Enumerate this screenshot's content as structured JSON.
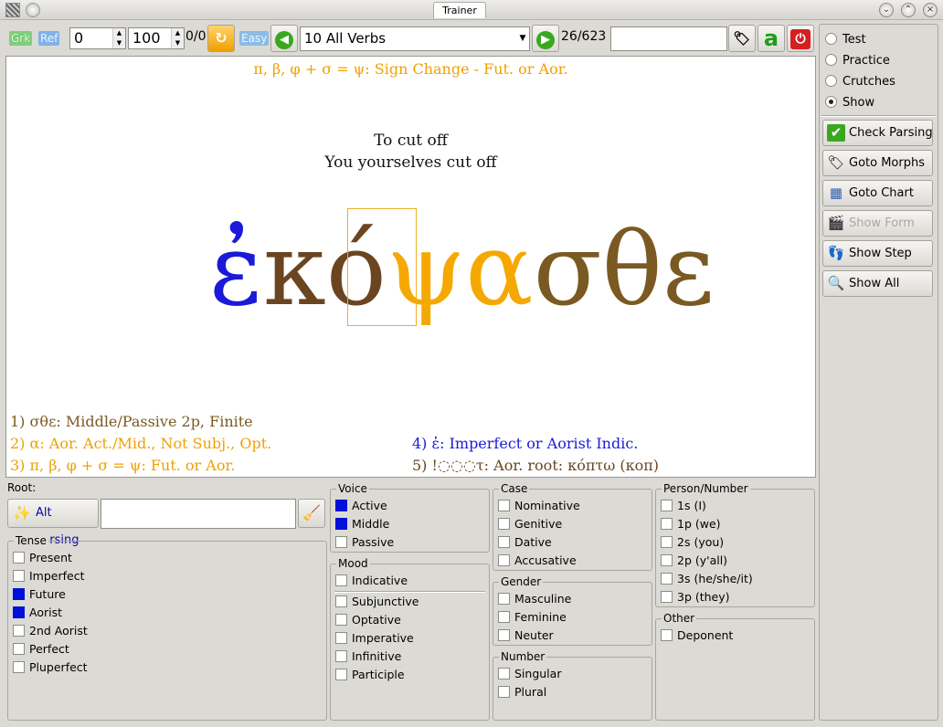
{
  "window": {
    "title": "Trainer",
    "minimize": "⌄",
    "maximize": "⌃",
    "close": "×"
  },
  "toolbar": {
    "grk_label": "Grk",
    "ref_label": "Ref",
    "range_start": "0",
    "range_end": "100",
    "score": "0/0",
    "easy_label": "Easy",
    "verb_set": "10 All Verbs",
    "position": "26/623",
    "search_value": "",
    "accent_glyph": "a"
  },
  "display": {
    "hint": "π, β, φ + σ = ψ: Sign Change - Fut. or Aor.",
    "gloss_lexical": "To cut off",
    "gloss_form": "You yourselves cut off",
    "word_parts": [
      {
        "text": "ἐ",
        "color": "#1a1ad8"
      },
      {
        "text": "κό",
        "color": "#6b4520"
      },
      {
        "text": "ψ",
        "color": "#f5a800"
      },
      {
        "text": "α",
        "color": "#f5a800"
      },
      {
        "text": "σθε",
        "color": "#7a5a22"
      }
    ],
    "steps": [
      {
        "text": "1) σθε: Middle/Passive 2p, Finite",
        "color": "#7a5a22"
      },
      {
        "text": "2) α: Aor. Act./Mid., Not Subj., Opt.",
        "color": "#f0a000"
      },
      {
        "text": "3) π, β, φ + σ = ψ: Fut. or Aor.",
        "color": "#f0a000"
      },
      {
        "text": "4) ἐ: Imperfect or Aorist Indic.",
        "color": "#1a1ad8"
      },
      {
        "text": "5) !◌◌◌τ: Aor. root: κόπτω (κοπ)",
        "color": "#6b4520"
      }
    ]
  },
  "modes": [
    {
      "label": "Test",
      "selected": false
    },
    {
      "label": "Practice",
      "selected": false
    },
    {
      "label": "Crutches",
      "selected": false
    },
    {
      "label": "Show",
      "selected": true
    }
  ],
  "side_buttons": [
    {
      "label": "Check Parsing",
      "icon": "checkmark-icon",
      "glyph": "✔",
      "enabled": true
    },
    {
      "label": "Goto Morphs",
      "icon": "tag-icon",
      "glyph": "🏷",
      "enabled": true
    },
    {
      "label": "Goto Chart",
      "icon": "table-icon",
      "glyph": "▦",
      "enabled": true
    },
    {
      "label": "Show Form",
      "icon": "clapper-icon",
      "glyph": "🎬",
      "enabled": false
    },
    {
      "label": "Show Step",
      "icon": "footprint-icon",
      "glyph": "👣",
      "enabled": true
    },
    {
      "label": "Show All",
      "icon": "magnifier-icon",
      "glyph": "🔍",
      "enabled": true
    }
  ],
  "root": {
    "label": "Root:",
    "alt_parsing_label": "Alt Parsing",
    "value": ""
  },
  "tense": {
    "title": "Tense",
    "items": [
      {
        "label": "Present",
        "checked": false
      },
      {
        "label": "Imperfect",
        "checked": false
      },
      {
        "label": "Future",
        "checked": true
      },
      {
        "label": "Aorist",
        "checked": true
      },
      {
        "label": "2nd Aorist",
        "checked": false
      },
      {
        "label": "Perfect",
        "checked": false
      },
      {
        "label": "Pluperfect",
        "checked": false
      }
    ]
  },
  "voice": {
    "title": "Voice",
    "items": [
      {
        "label": "Active",
        "checked": true
      },
      {
        "label": "Middle",
        "checked": true
      },
      {
        "label": "Passive",
        "checked": false
      }
    ]
  },
  "mood": {
    "title": "Mood",
    "items": [
      {
        "label": "Indicative",
        "checked": false
      },
      {
        "label": "Subjunctive",
        "checked": false
      },
      {
        "label": "Optative",
        "checked": false
      },
      {
        "label": "Imperative",
        "checked": false
      },
      {
        "label": "Infinitive",
        "checked": false
      },
      {
        "label": "Participle",
        "checked": false
      }
    ]
  },
  "case": {
    "title": "Case",
    "items": [
      {
        "label": "Nominative",
        "checked": false
      },
      {
        "label": "Genitive",
        "checked": false
      },
      {
        "label": "Dative",
        "checked": false
      },
      {
        "label": "Accusative",
        "checked": false
      }
    ]
  },
  "gender": {
    "title": "Gender",
    "items": [
      {
        "label": "Masculine",
        "checked": false
      },
      {
        "label": "Feminine",
        "checked": false
      },
      {
        "label": "Neuter",
        "checked": false
      }
    ]
  },
  "number": {
    "title": "Number",
    "items": [
      {
        "label": "Singular",
        "checked": false
      },
      {
        "label": "Plural",
        "checked": false
      }
    ]
  },
  "person": {
    "title": "Person/Number",
    "items": [
      {
        "label": "1s (I)",
        "checked": false
      },
      {
        "label": "1p (we)",
        "checked": false
      },
      {
        "label": "2s (you)",
        "checked": false
      },
      {
        "label": "2p (y'all)",
        "checked": false
      },
      {
        "label": "3s (he/she/it)",
        "checked": false
      },
      {
        "label": "3p (they)",
        "checked": false
      }
    ]
  },
  "other": {
    "title": "Other",
    "items": [
      {
        "label": "Deponent",
        "checked": false
      }
    ]
  }
}
